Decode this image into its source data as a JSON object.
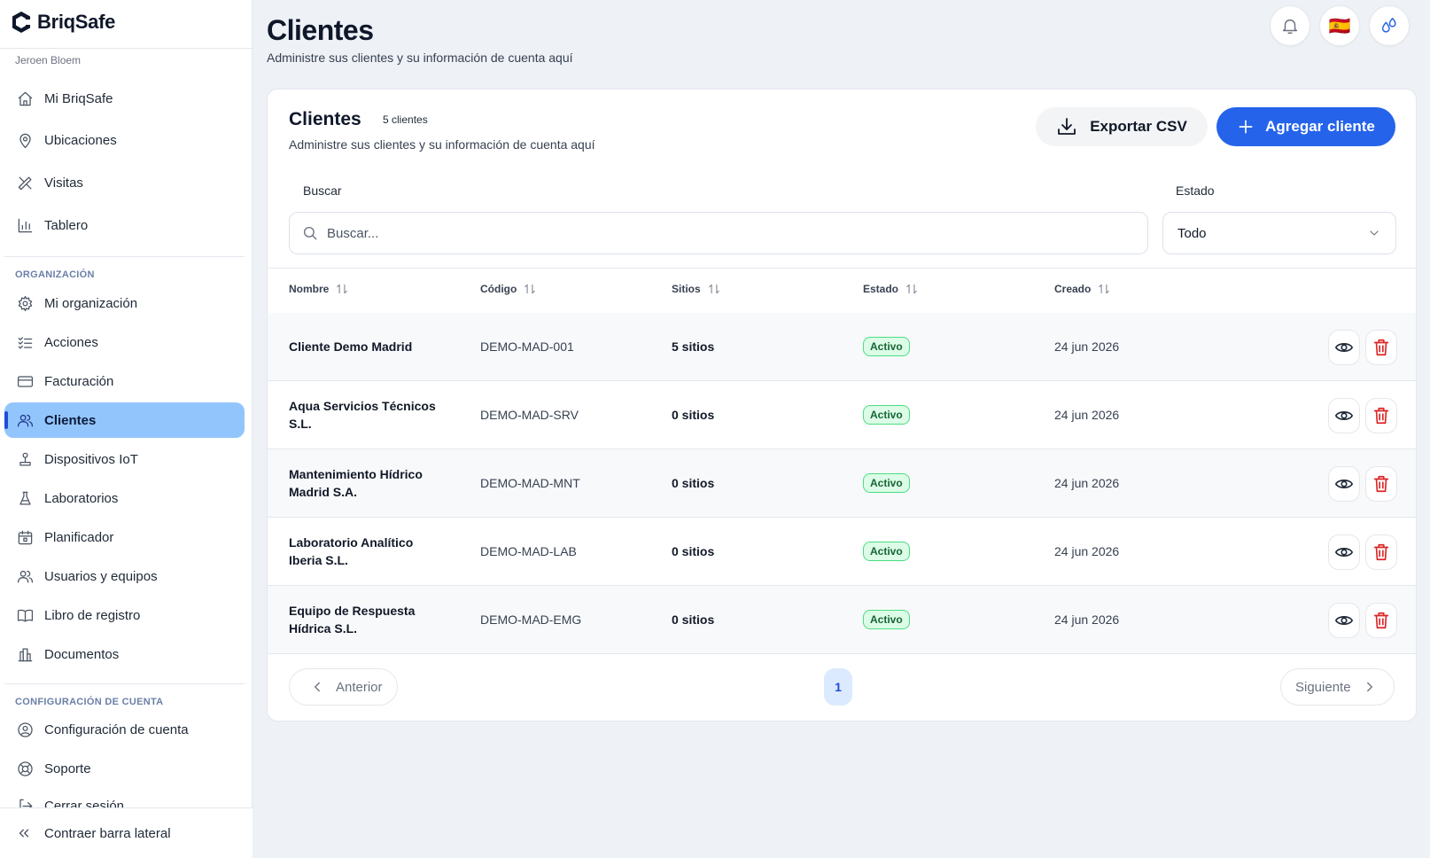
{
  "app": {
    "name": "BriqSafe",
    "user": "Jeroen Bloem"
  },
  "sidebar": {
    "main_items": [
      {
        "label": "Mi BriqSafe",
        "icon": "home-icon"
      },
      {
        "label": "Ubicaciones",
        "icon": "map-pin-icon"
      },
      {
        "label": "Visitas",
        "icon": "tools-icon"
      },
      {
        "label": "Tablero",
        "icon": "bar-chart-icon"
      }
    ],
    "section_org": "ORGANIZACIÓN",
    "org_items": [
      {
        "label": "Mi organización",
        "icon": "gear-icon"
      },
      {
        "label": "Acciones",
        "icon": "list-check-icon"
      },
      {
        "label": "Facturación",
        "icon": "credit-card-icon"
      },
      {
        "label": "Clientes",
        "icon": "users-icon",
        "active": true
      },
      {
        "label": "Dispositivos IoT",
        "icon": "sensor-icon"
      },
      {
        "label": "Laboratorios",
        "icon": "flask-icon"
      },
      {
        "label": "Planificador",
        "icon": "calendar-icon"
      },
      {
        "label": "Usuarios y equipos",
        "icon": "users-icon"
      },
      {
        "label": "Libro de registro",
        "icon": "book-icon"
      },
      {
        "label": "Documentos",
        "icon": "documents-icon"
      }
    ],
    "section_account": "CONFIGURACIÓN DE CUENTA",
    "account_items": [
      {
        "label": "Configuración de cuenta",
        "icon": "user-circle-icon"
      },
      {
        "label": "Soporte",
        "icon": "lifebuoy-icon"
      },
      {
        "label": "Cerrar sesión",
        "icon": "logout-icon"
      }
    ],
    "collapse_label": "Contraer barra lateral"
  },
  "header": {
    "title": "Clientes",
    "subtitle": "Administre sus clientes y su información de cuenta aquí",
    "flag": "🇪🇸"
  },
  "card": {
    "title": "Clientes",
    "count": "5 clientes",
    "subtitle": "Administre sus clientes y su información de cuenta aquí",
    "export_label": "Exportar CSV",
    "add_label": "Agregar cliente",
    "search_label": "Buscar",
    "search_placeholder": "Buscar...",
    "status_label": "Estado",
    "status_value": "Todo"
  },
  "table": {
    "columns": [
      "Nombre",
      "Código",
      "Sitios",
      "Estado",
      "Creado"
    ],
    "rows": [
      {
        "name": "Cliente Demo Madrid",
        "code": "DEMO-MAD-001",
        "sites": "5 sitios",
        "status": "Activo",
        "created": "24 jun 2026"
      },
      {
        "name": "Aqua Servicios Técnicos S.L.",
        "code": "DEMO-MAD-SRV",
        "sites": "0 sitios",
        "status": "Activo",
        "created": "24 jun 2026"
      },
      {
        "name": "Mantenimiento Hídrico Madrid S.A.",
        "code": "DEMO-MAD-MNT",
        "sites": "0 sitios",
        "status": "Activo",
        "created": "24 jun 2026"
      },
      {
        "name": "Laboratorio Analítico Iberia S.L.",
        "code": "DEMO-MAD-LAB",
        "sites": "0 sitios",
        "status": "Activo",
        "created": "24 jun 2026"
      },
      {
        "name": "Equipo de Respuesta Hídrica S.L.",
        "code": "DEMO-MAD-EMG",
        "sites": "0 sitios",
        "status": "Activo",
        "created": "24 jun 2026"
      }
    ]
  },
  "pagination": {
    "prev": "Anterior",
    "next": "Siguiente",
    "current": "1"
  },
  "colors": {
    "accent": "#2563eb",
    "active_nav": "#93c5fd",
    "status_green": "#166534",
    "delete_red": "#dc2626"
  }
}
